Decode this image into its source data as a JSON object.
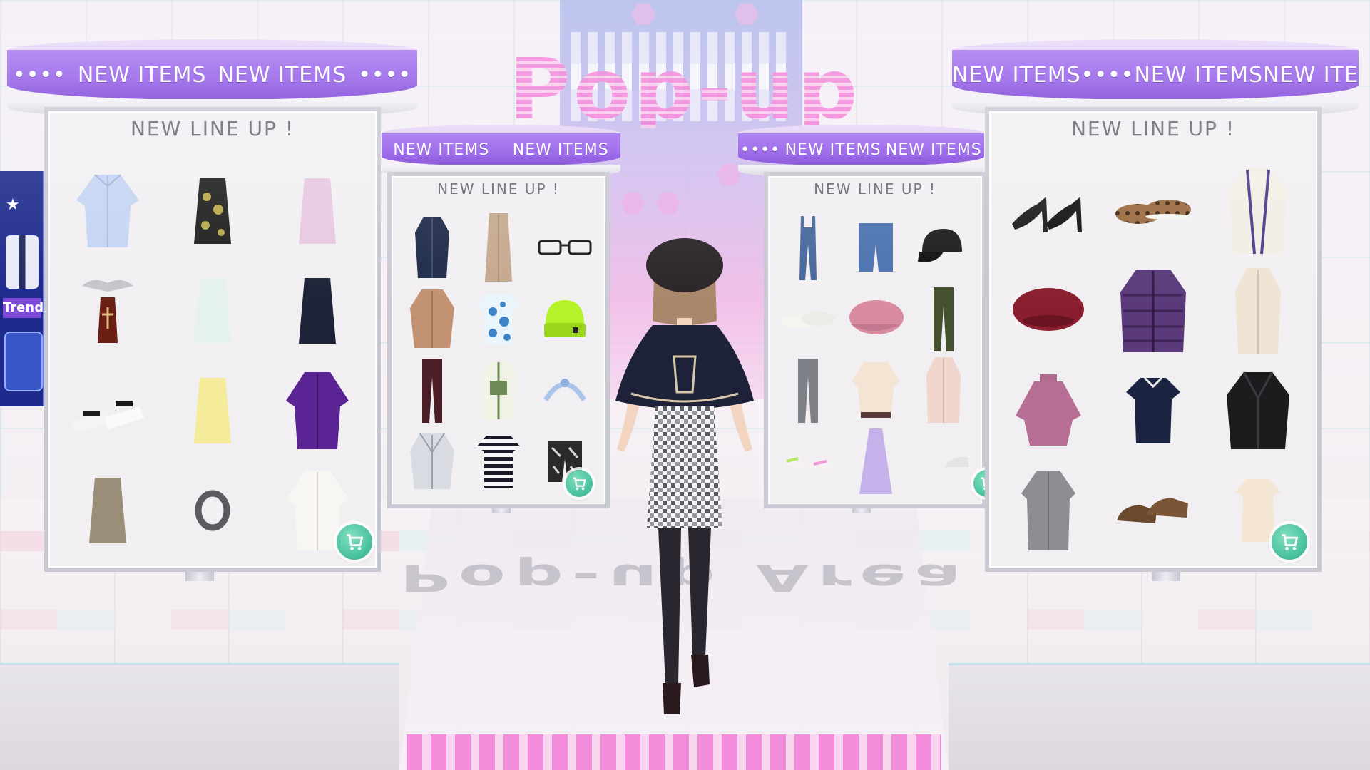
{
  "scene": {
    "area_sign": "Pop-up Area",
    "floor_sign": "Pop-up Area"
  },
  "side_store": {
    "label": "Trend"
  },
  "kiosks": {
    "band_text": "NEW ITEMS",
    "band_dots": "••••",
    "board_title": "NEW LINE UP !",
    "far_left": {
      "items": [
        "light-blue-shirt-item",
        "black-floral-top-item",
        "lilac-tank-item",
        "bat-coffin-necklace-item",
        "mint-tank-item",
        "navy-tank-item",
        "white-platform-sandals-item",
        "yellow-tank-item",
        "purple-blouse-item",
        "khaki-tank-item",
        "silver-bangle-item",
        "white-shirt-item"
      ]
    },
    "center_left": {
      "items": [
        "navy-coat-item",
        "beige-long-vest-item",
        "black-glasses-item",
        "camel-jacket-item",
        "blue-spot-tee-item",
        "lime-beanie-item",
        "burgundy-pants-item",
        "green-fleece-vest-item",
        "blue-headband-item",
        "silver-jacket-item",
        "striped-tee-item",
        "leaf-print-shorts-item"
      ]
    },
    "center_right": {
      "items": [
        "denim-overalls-item",
        "denim-shorts-item",
        "black-cap-item",
        "white-flats-item",
        "pink-casquette-item",
        "olive-pants-item",
        "grey-pants-item",
        "cream-sweater-item",
        "pink-coat-item",
        "pastel-sneakers-item",
        "lavender-dress-item",
        "white-sandals-item"
      ]
    },
    "far_right": {
      "items": [
        "black-heels-item",
        "leopard-slip-ons-item",
        "cream-cardigan-item",
        "burgundy-beret-item",
        "purple-puffer-item",
        "beige-trench-item",
        "mauve-turtleneck-item",
        "navy-polo-item",
        "black-leather-jacket-item",
        "grey-shirt-item",
        "brown-loafers-item",
        "cream-tee-item"
      ]
    }
  },
  "colors": {
    "band": "#9058e6",
    "cart": "#2db08c",
    "neon": "#f27ad6"
  }
}
